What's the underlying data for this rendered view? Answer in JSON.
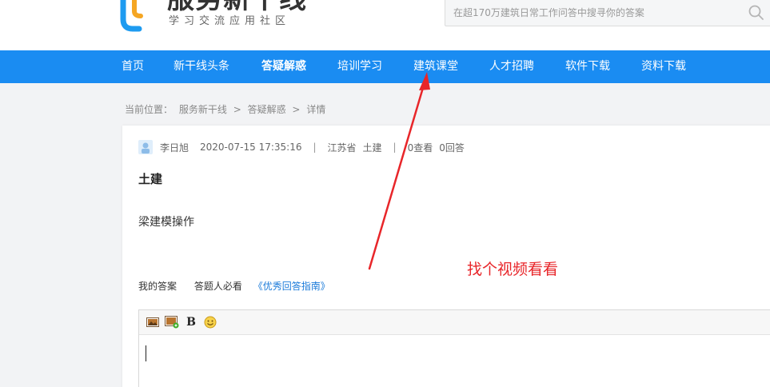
{
  "header": {
    "logo_title": "服务新干线",
    "logo_subtitle": "学习交流应用社区",
    "search_placeholder": "在超170万建筑日常工作问答中搜寻你的答案"
  },
  "nav": {
    "items": [
      {
        "label": "首页"
      },
      {
        "label": "新干线头条"
      },
      {
        "label": "答疑解惑",
        "active": true
      },
      {
        "label": "培训学习"
      },
      {
        "label": "建筑课堂"
      },
      {
        "label": "人才招聘"
      },
      {
        "label": "软件下载"
      },
      {
        "label": "资料下载"
      }
    ]
  },
  "breadcrumb": {
    "prefix": "当前位置：",
    "items": [
      "服务新干线",
      ">",
      "答疑解惑",
      ">",
      "详情"
    ]
  },
  "question": {
    "author": "李日旭",
    "datetime": "2020-07-15 17:35:16",
    "separator": "|",
    "province": "江苏省",
    "category_tag": "土建",
    "views": "0查看",
    "answers": "0回答",
    "category": "土建",
    "body": "梁建模操作"
  },
  "answer": {
    "label": "我的答案",
    "must_read": "答题人必看",
    "guide_link": "《优秀回答指南》"
  },
  "annotation": {
    "text": "找个视频看看",
    "color": "#e8262a"
  },
  "colors": {
    "nav_bg": "#1a8cf2",
    "link": "#1a7ad9"
  },
  "icons": {
    "toolbar": [
      "image-icon",
      "insert-image-icon",
      "bold-icon",
      "emoji-icon"
    ]
  },
  "toolbar": {
    "bold_label": "B"
  }
}
